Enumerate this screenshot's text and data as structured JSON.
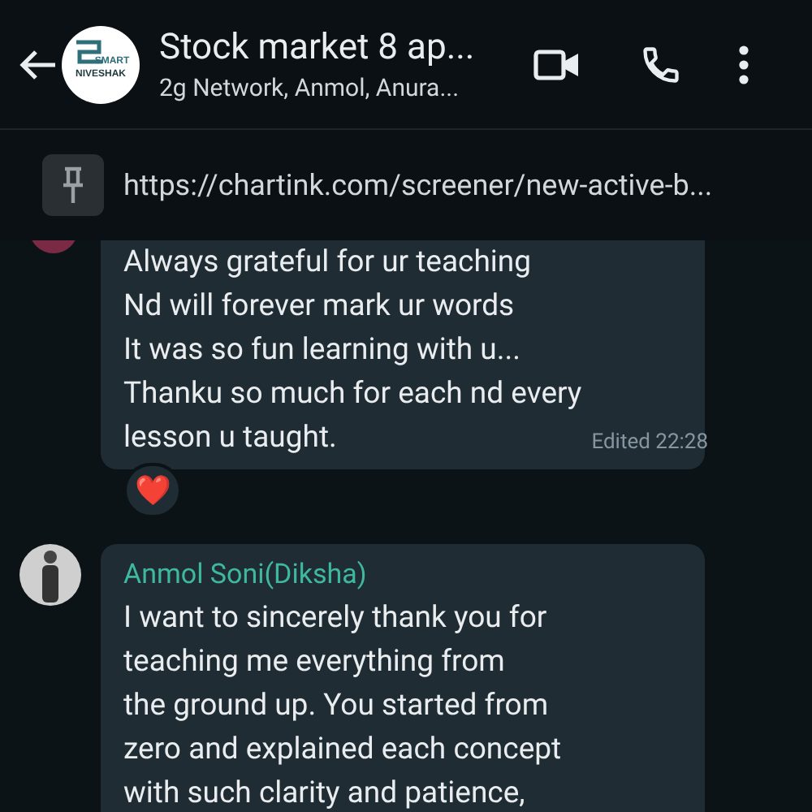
{
  "header": {
    "logo_text": [
      "SMART",
      "NIVESHAK"
    ],
    "title": "Stock market 8 ap...",
    "subtitle": "2g Network, Anmol, Anura..."
  },
  "pinned": {
    "text": "https://chartink.com/screener/new-active-b..."
  },
  "messages": [
    {
      "text": "Always grateful for ur teaching\nNd will forever mark ur words\nIt was so fun learning with u...\nThanku so much for each nd every\nlesson u taught.",
      "meta": "Edited 22:28",
      "reaction": "❤️"
    },
    {
      "sender": "Anmol Soni(Diksha)",
      "text": "I want to sincerely thank you for\nteaching me everything from\nthe ground up. You started from\nzero and explained each concept\nwith such clarity and patience,"
    }
  ]
}
